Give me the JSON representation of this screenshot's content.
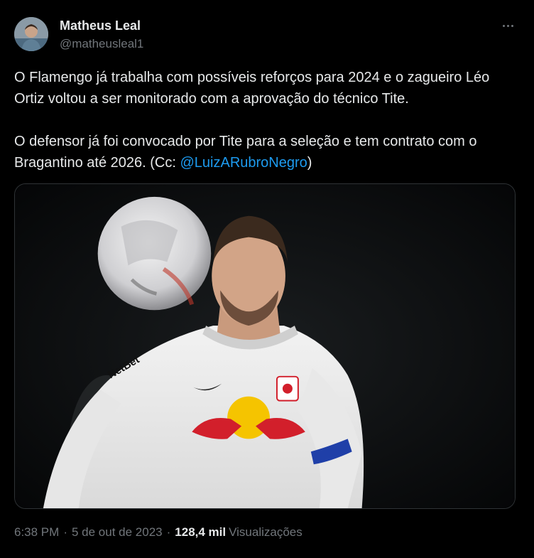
{
  "author": {
    "display_name": "Matheus Leal",
    "handle": "@matheusleal1"
  },
  "tweet": {
    "paragraph1": "O Flamengo já trabalha com possíveis reforços para 2024 e o zagueiro Léo Ortiz voltou a ser monitorado com a aprovação do técnico Tite.",
    "paragraph2_text": "O defensor já foi convocado por Tite para a seleção e tem contrato com o Bragantino até 2026. (Cc: ",
    "mention": "@LuizARubroNegro",
    "paragraph2_close": ")"
  },
  "media": {
    "jersey_text": "NetBet"
  },
  "meta": {
    "time": "6:38 PM",
    "separator": "·",
    "date": "5 de out de 2023",
    "views_count": "128,4 mil",
    "views_label": "Visualizações"
  },
  "icons": {
    "more": "more-horizontal-icon"
  },
  "colors": {
    "background": "#000000",
    "text_primary": "#e7e9ea",
    "text_secondary": "#71767b",
    "link": "#1d9bf0"
  }
}
